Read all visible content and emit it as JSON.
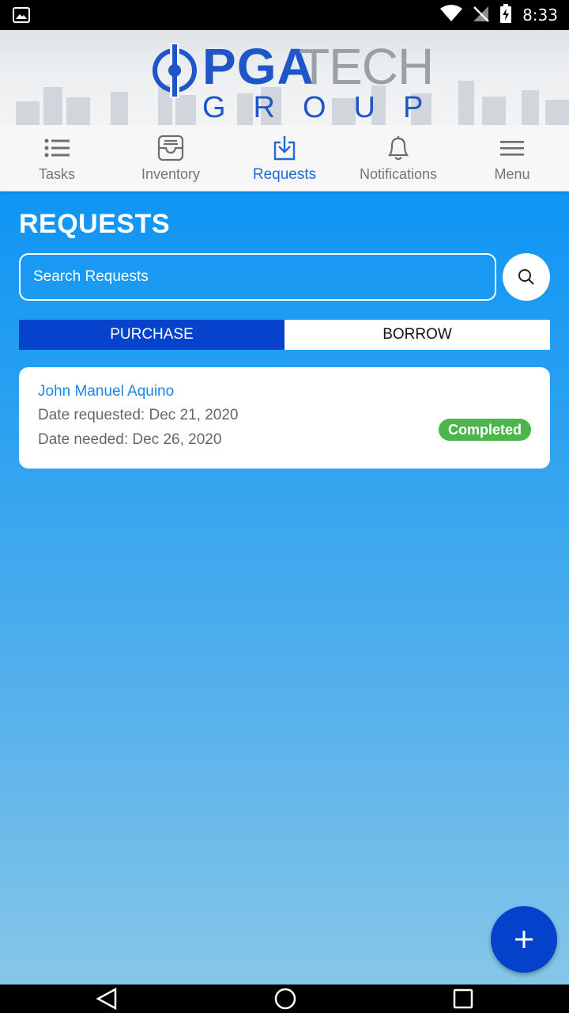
{
  "status_bar": {
    "time": "8:33",
    "icons": [
      "image-icon",
      "wifi-icon",
      "signal-icon",
      "battery-icon"
    ]
  },
  "brand": {
    "primary": "PGA",
    "secondary": "TECH",
    "tagline": "GROUP",
    "color": "#1e55c8"
  },
  "tabs": [
    {
      "label": "Tasks",
      "icon": "list-icon",
      "active": false
    },
    {
      "label": "Inventory",
      "icon": "inbox-icon",
      "active": false
    },
    {
      "label": "Requests",
      "icon": "download-tray-icon",
      "active": true
    },
    {
      "label": "Notifications",
      "icon": "bell-icon",
      "active": false
    },
    {
      "label": "Menu",
      "icon": "hamburger-icon",
      "active": false
    }
  ],
  "page": {
    "title": "REQUESTS"
  },
  "search": {
    "placeholder": "Search Requests",
    "value": ""
  },
  "segments": {
    "purchase": "PURCHASE",
    "borrow": "BORROW",
    "selected": "PURCHASE"
  },
  "requests": [
    {
      "name": "John Manuel Aquino",
      "requested": "Date requested: Dec 21, 2020",
      "needed": "Date needed: Dec 26, 2020",
      "status": "Completed"
    }
  ],
  "colors": {
    "accent": "#1f6ad9",
    "fab": "#0542cc",
    "segment_active": "#0543cc",
    "status_completed": "#4cb54c",
    "link": "#1d86e6"
  },
  "fab": {
    "icon": "plus-icon"
  },
  "system_nav": [
    "back-icon",
    "home-icon",
    "recents-icon"
  ]
}
